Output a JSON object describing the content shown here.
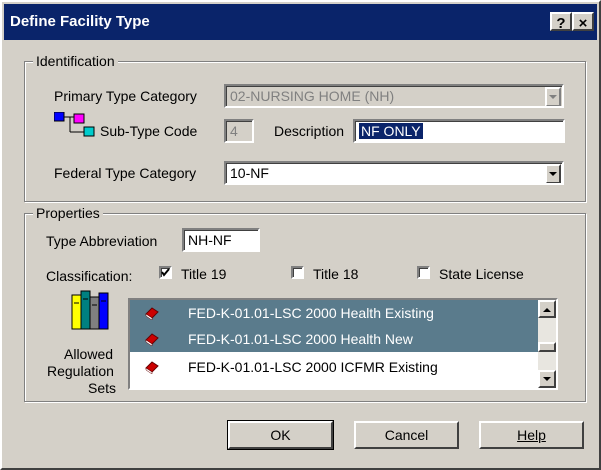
{
  "window": {
    "title": "Define Facility Type",
    "help_btn": "?",
    "close_btn": "×"
  },
  "identification": {
    "group_label": "Identification",
    "primary_label": "Primary Type Category",
    "primary_value": "02-NURSING HOME (NH)",
    "subtype_label": "Sub-Type Code",
    "subtype_value": "4",
    "description_label": "Description",
    "description_value": "NF ONLY",
    "federal_label": "Federal Type Category",
    "federal_value": "10-NF"
  },
  "properties": {
    "group_label": "Properties",
    "abbrev_label": "Type Abbreviation",
    "abbrev_value": "NH-NF",
    "classification_label": "Classification:",
    "checkboxes": [
      {
        "label": "Title 19",
        "checked": true
      },
      {
        "label": "Title 18",
        "checked": false
      },
      {
        "label": "State License",
        "checked": false
      }
    ],
    "regsets_label_1": "Allowed",
    "regsets_label_2": "Regulation",
    "regsets_label_3": "Sets",
    "regsets": [
      {
        "label": "FED-K-01.01-LSC 2000 Health Existing",
        "selected": true
      },
      {
        "label": "FED-K-01.01-LSC 2000 Health New",
        "selected": true
      },
      {
        "label": "FED-K-01.01-LSC 2000 ICFMR Existing",
        "selected": false
      }
    ]
  },
  "buttons": {
    "ok": "OK",
    "cancel": "Cancel",
    "help": "Help"
  },
  "colors": {
    "titlebar": "#0a246a",
    "selection": "#5a7b8c",
    "face": "#d4d0c8"
  }
}
